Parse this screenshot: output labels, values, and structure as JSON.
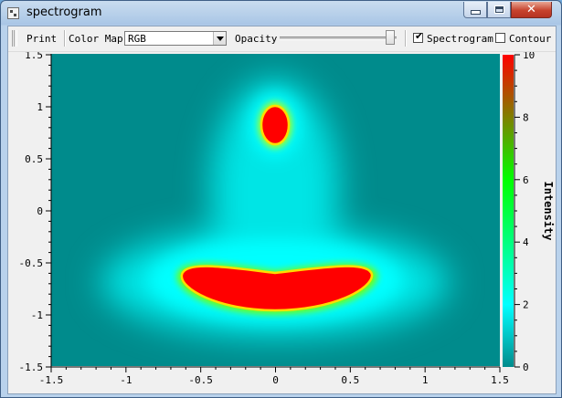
{
  "window": {
    "title": "spectrogram",
    "controls": {
      "minimize": "minimize-icon",
      "maximize": "maximize-icon",
      "close": "close-icon"
    }
  },
  "toolbar": {
    "print_label": "Print",
    "color_map_label": "Color Map",
    "color_map_selected": "RGB",
    "opacity_label": "Opacity",
    "opacity_value": 0.95,
    "spectrogram_label": "Spectrogram",
    "spectrogram_checked": true,
    "contour_label": "Contour",
    "contour_checked": false
  },
  "chart_data": {
    "type": "heatmap",
    "xlim": [
      -1.5,
      1.5
    ],
    "ylim": [
      -1.5,
      1.5
    ],
    "x_ticks": [
      "-1.5",
      "-1",
      "-0.5",
      "0",
      "0.5",
      "1",
      "1.5"
    ],
    "y_ticks": [
      "1.5",
      "1",
      "0.5",
      "0",
      "-0.5",
      "-1",
      "-1.5"
    ],
    "colorbar": {
      "label": "Intensity",
      "range": [
        0,
        10
      ],
      "ticks": [
        "10",
        "8",
        "6",
        "4",
        "2",
        "0"
      ],
      "stops": [
        {
          "value": 0,
          "color": "#008b8c"
        },
        {
          "value": 2,
          "color": "#00ffff"
        },
        {
          "value": 6,
          "color": "#00ff00"
        },
        {
          "value": 10,
          "color": "#ff0000"
        }
      ]
    },
    "features": [
      {
        "name": "upper-peak",
        "center_x": 0.0,
        "center_y": 0.83,
        "max_value": 10
      },
      {
        "name": "lower-band",
        "center_x": 0.0,
        "center_y": -0.75,
        "max_value": 10
      }
    ]
  }
}
